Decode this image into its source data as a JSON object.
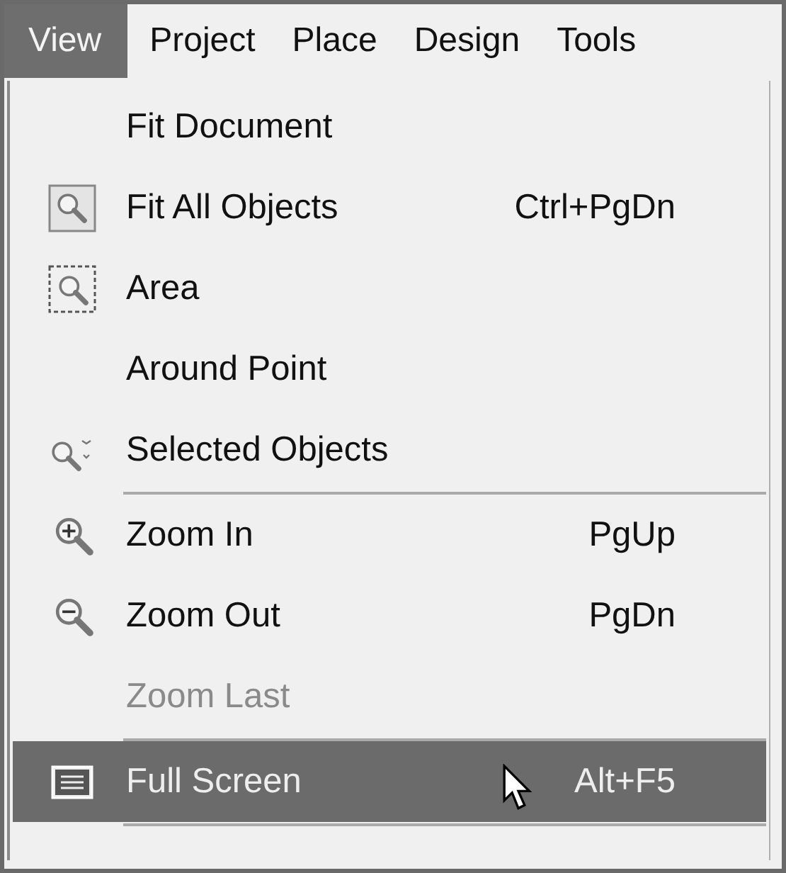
{
  "menu_bar": [
    {
      "label": "View",
      "selected": true
    },
    {
      "label": "Project",
      "selected": false
    },
    {
      "label": "Place",
      "selected": false
    },
    {
      "label": "Design",
      "selected": false
    },
    {
      "label": "Tools",
      "selected": false
    }
  ],
  "menu": {
    "items": [
      {
        "kind": "item",
        "label": "Fit Document",
        "selected": false,
        "disabled": false
      },
      {
        "kind": "item",
        "label": "Fit All Objects",
        "shortcut": "Ctrl+PgDn",
        "selected": false,
        "disabled": false
      },
      {
        "kind": "item",
        "label": "Area",
        "selected": false,
        "disabled": false
      },
      {
        "kind": "item",
        "label": "Around Point",
        "selected": false,
        "disabled": false
      },
      {
        "kind": "item",
        "label": "Selected Objects",
        "selected": false,
        "disabled": false
      },
      {
        "kind": "separator"
      },
      {
        "kind": "item",
        "label": "Zoom In",
        "shortcut": "PgUp",
        "selected": false,
        "disabled": false
      },
      {
        "kind": "item",
        "label": "Zoom Out",
        "shortcut": "PgDn",
        "selected": false,
        "disabled": false
      },
      {
        "kind": "item",
        "label": "Zoom Last",
        "selected": false,
        "disabled": true
      },
      {
        "kind": "separator"
      },
      {
        "kind": "item",
        "label": "Full Screen",
        "shortcut": "Alt+F5",
        "selected": true,
        "disabled": false
      },
      {
        "kind": "separator"
      }
    ]
  }
}
